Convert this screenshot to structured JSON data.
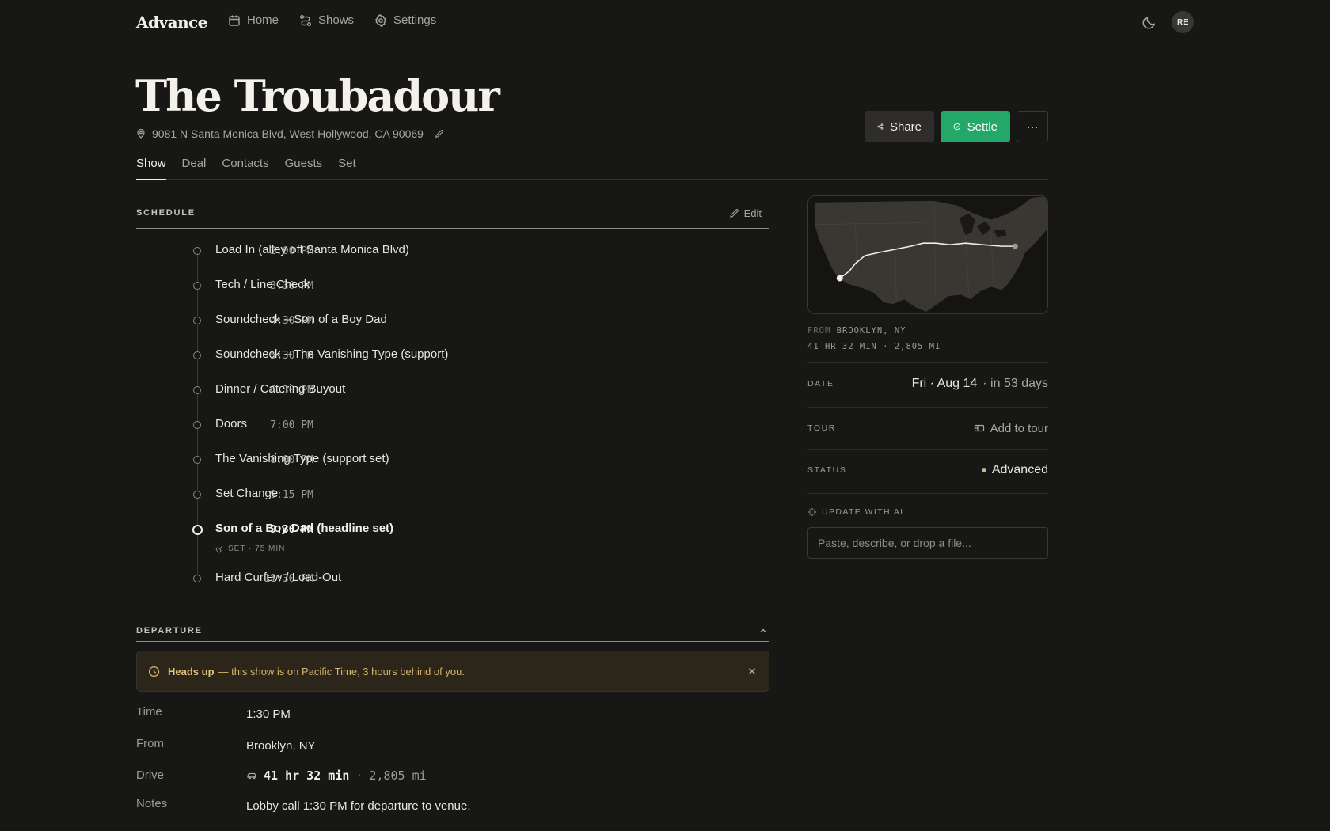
{
  "app": {
    "brand": "Advance",
    "avatar_initials": "RE"
  },
  "nav": {
    "items": [
      {
        "label": "Home",
        "icon": "calendar-icon"
      },
      {
        "label": "Shows",
        "icon": "route-icon"
      },
      {
        "label": "Settings",
        "icon": "gear-icon"
      }
    ]
  },
  "header": {
    "title": "The Troubadour",
    "address": "9081 N Santa Monica Blvd, West Hollywood, CA 90069",
    "share_label": "Share",
    "settle_label": "Settle",
    "more_label": "···"
  },
  "tabs": [
    "Show",
    "Deal",
    "Contacts",
    "Guests",
    "Set"
  ],
  "schedule": {
    "label": "SCHEDULE",
    "edit_label": "Edit",
    "items": [
      {
        "time": "2:00 PM",
        "event": "Load In (alley off Santa Monica Blvd)"
      },
      {
        "time": "3:30 PM",
        "event": "Tech / Line Check"
      },
      {
        "time": "4:30 PM",
        "event": "Soundcheck – Son of a Boy Dad"
      },
      {
        "time": "5:30 PM",
        "event": "Soundcheck – The Vanishing Type (support)"
      },
      {
        "time": "6:30 PM",
        "event": "Dinner / Catering Buyout"
      },
      {
        "time": "7:00 PM",
        "event": "Doors"
      },
      {
        "time": "8:00 PM",
        "event": "The Vanishing Type (support set)"
      },
      {
        "time": "9:15 PM",
        "event": "Set Change"
      },
      {
        "time": "9:30 PM",
        "event": "Son of a Boy Dad (headline set)",
        "meta": "SET · 75 MIN"
      },
      {
        "time": "11:30 PM",
        "event": "Hard Curfew / Load-Out"
      }
    ]
  },
  "departure": {
    "label": "DEPARTURE",
    "alert_strong": "Heads up",
    "alert_text": "— this show is on Pacific Time, 3 hours behind of you.",
    "time_label": "Time",
    "time_value": "1:30 PM",
    "from_label": "From",
    "from_value": "Brooklyn, NY",
    "drive_label": "Drive",
    "drive_duration": "41 hr 32 min",
    "drive_sep": "·",
    "drive_distance": "2,805 mi",
    "notes_label": "Notes",
    "notes_value": "Lobby call 1:30 PM for departure to venue."
  },
  "route": {
    "from_prefix": "FROM",
    "from_city": "BROOKLYN, NY",
    "summary": "41 HR 32 MIN · 2,805 MI"
  },
  "details": {
    "date_label": "DATE",
    "date_value": "Fri · Aug 14",
    "date_relative": "· in 53 days",
    "tour_label": "TOUR",
    "tour_value": "Add to tour",
    "status_label": "STATUS",
    "status_value": "Advanced"
  },
  "ai": {
    "label": "UPDATE WITH AI",
    "placeholder": "Paste, describe, or drop a file..."
  },
  "colors": {
    "accent_green": "#23a869",
    "alert_bg": "#2b251a",
    "alert_text": "#d7b56d",
    "background": "#171716"
  }
}
